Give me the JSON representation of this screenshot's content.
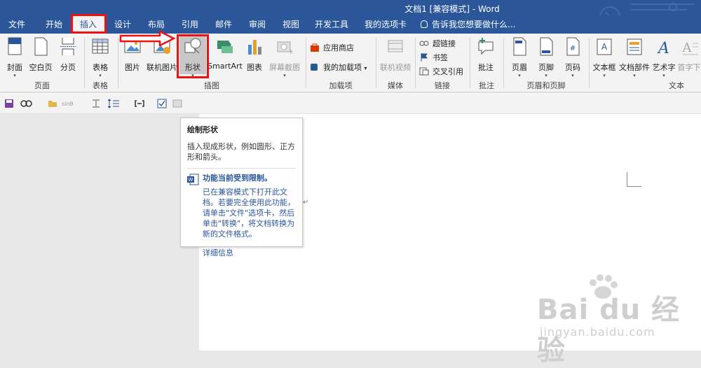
{
  "app": {
    "title": "文档1 [兼容模式] - Word"
  },
  "tabs": [
    {
      "label": "文件"
    },
    {
      "label": "开始"
    },
    {
      "label": "插入"
    },
    {
      "label": "设计"
    },
    {
      "label": "布局"
    },
    {
      "label": "引用"
    },
    {
      "label": "邮件"
    },
    {
      "label": "审阅"
    },
    {
      "label": "视图"
    },
    {
      "label": "开发工具"
    },
    {
      "label": "我的选项卡"
    }
  ],
  "active_tab": "插入",
  "tell_me": "告诉我您想要做什么...",
  "ribbon": {
    "pages": {
      "cover": "封面",
      "blank": "空白页",
      "break": "分页",
      "group": "页面"
    },
    "tables": {
      "table": "表格",
      "group": "表格"
    },
    "illustrations": {
      "picture": "图片",
      "online_picture": "联机图片",
      "shapes": "形状",
      "smartart": "SmartArt",
      "chart": "图表",
      "screenshot": "屏幕截图",
      "group": "插图"
    },
    "addins": {
      "store": "应用商店",
      "my_addins": "我的加载项",
      "group": "加载项"
    },
    "media": {
      "online_video": "联机视频",
      "group": "媒体"
    },
    "links": {
      "hyperlink": "超链接",
      "bookmark": "书签",
      "cross_ref": "交叉引用",
      "group": "链接"
    },
    "comments": {
      "comment": "批注",
      "group": "批注"
    },
    "header_footer": {
      "header": "页眉",
      "footer": "页脚",
      "page_number": "页码",
      "group": "页眉和页脚"
    },
    "text": {
      "textbox": "文本框",
      "quick_parts": "文档部件",
      "wordart": "艺术字",
      "dropcap": "首字下",
      "group": "文本"
    }
  },
  "tooltip": {
    "title": "绘制形状",
    "description": "插入现成形状，例如圆形、正方形和箭头。",
    "warning_title": "功能当前受到限制。",
    "warning_body": "已在兼容模式下打开此文档。若要完全使用此功能，请单击\"文件\"选项卡，然后单击\"转换\"，将文档转换为新的文件格式。",
    "more_info": "详细信息"
  },
  "watermark": {
    "brand": "Bai du 经验",
    "url": "jingyan.baidu.com"
  },
  "colors": {
    "word_blue": "#2b579a",
    "highlight_red": "#e11111"
  }
}
